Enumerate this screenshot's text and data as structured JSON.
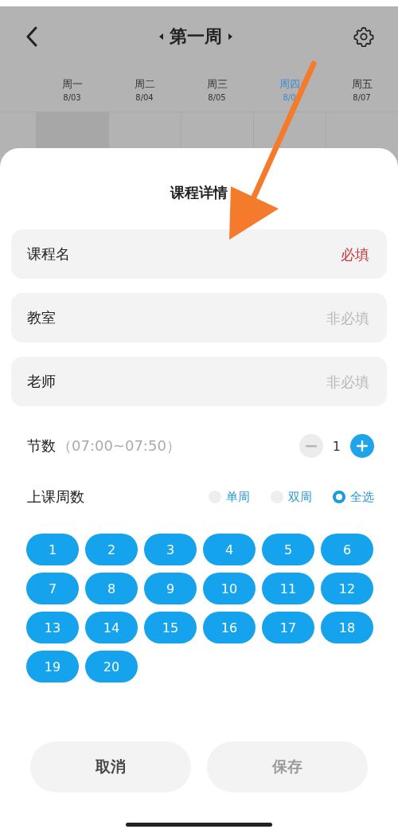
{
  "header": {
    "title": "第一周",
    "days": [
      {
        "day": "周一",
        "date": "8/03",
        "selected": false
      },
      {
        "day": "周二",
        "date": "8/04",
        "selected": false
      },
      {
        "day": "周三",
        "date": "8/05",
        "selected": false
      },
      {
        "day": "周四",
        "date": "8/0",
        "selected": true
      },
      {
        "day": "周五",
        "date": "8/07",
        "selected": false
      }
    ]
  },
  "sheet": {
    "title": "课程详情",
    "fields": [
      {
        "label": "课程名",
        "placeholder": "必填",
        "required": true
      },
      {
        "label": "教室",
        "placeholder": "非必填",
        "required": false
      },
      {
        "label": "老师",
        "placeholder": "非必填",
        "required": false
      }
    ],
    "periods": {
      "label": "节数",
      "time": "（07:00~07:50）",
      "value": "1"
    },
    "weeks": {
      "label": "上课周数",
      "modes": [
        {
          "label": "单周",
          "selected": false
        },
        {
          "label": "双周",
          "selected": false
        },
        {
          "label": "全选",
          "selected": true
        }
      ],
      "items": [
        {
          "label": "1",
          "selected": true
        },
        {
          "label": "2",
          "selected": true
        },
        {
          "label": "3",
          "selected": true
        },
        {
          "label": "4",
          "selected": true
        },
        {
          "label": "5",
          "selected": true
        },
        {
          "label": "6",
          "selected": true
        },
        {
          "label": "7",
          "selected": true
        },
        {
          "label": "8",
          "selected": true
        },
        {
          "label": "9",
          "selected": true
        },
        {
          "label": "10",
          "selected": true
        },
        {
          "label": "11",
          "selected": true
        },
        {
          "label": "12",
          "selected": true
        },
        {
          "label": "13",
          "selected": true
        },
        {
          "label": "14",
          "selected": true
        },
        {
          "label": "15",
          "selected": true
        },
        {
          "label": "16",
          "selected": true
        },
        {
          "label": "17",
          "selected": true
        },
        {
          "label": "18",
          "selected": true
        },
        {
          "label": "19",
          "selected": true
        },
        {
          "label": "20",
          "selected": true
        }
      ]
    },
    "buttons": [
      {
        "label": "取消",
        "disabled": false
      },
      {
        "label": "保存",
        "disabled": true
      }
    ]
  }
}
